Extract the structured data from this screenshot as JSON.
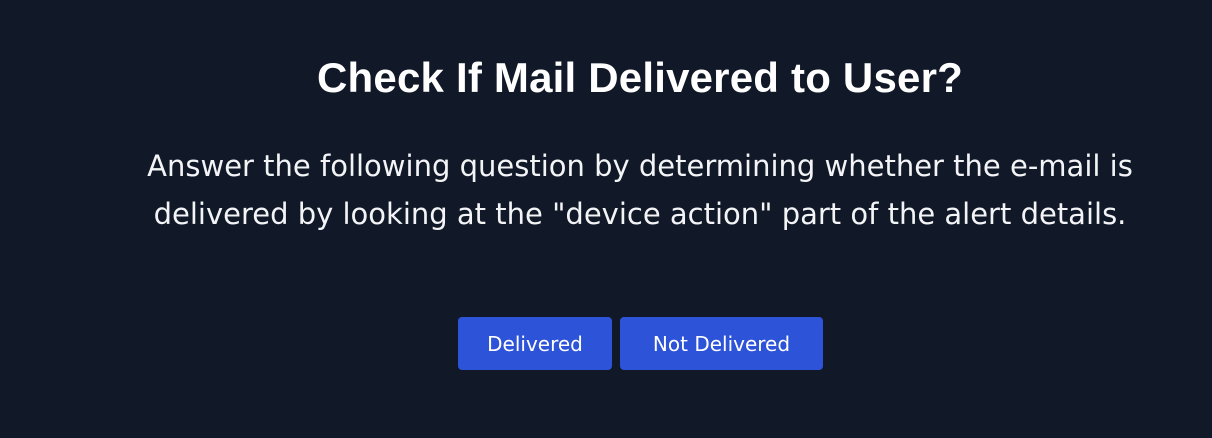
{
  "dialog": {
    "title": "Check If Mail Delivered to User?",
    "description": "Answer the following question by determining whether the e-mail is delivered by looking at the \"device action\" part of the alert details.",
    "buttons": {
      "delivered_label": "Delivered",
      "not_delivered_label": "Not Delivered"
    }
  },
  "colors": {
    "background": "#111827",
    "button_background": "#2d53d8",
    "text": "#ffffff"
  }
}
